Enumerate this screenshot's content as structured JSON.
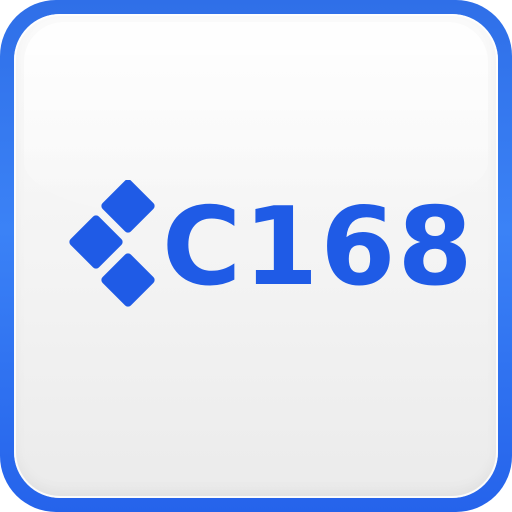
{
  "logo": {
    "text": "C168",
    "mark": "diamond-tiles-icon",
    "brand_color": "#1f5be6",
    "frame_color": "#2f6fe8"
  }
}
